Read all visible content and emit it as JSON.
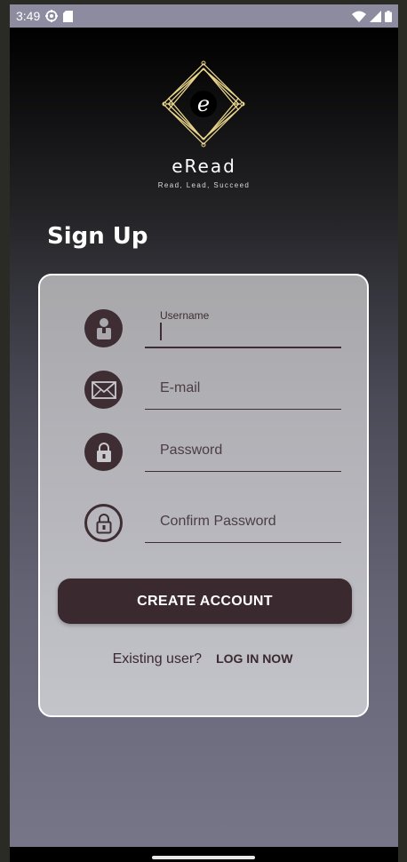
{
  "status_bar": {
    "time": "3:49",
    "left_icons": [
      "settings-icon",
      "sd-card-icon"
    ],
    "right_icons": [
      "wifi-icon",
      "signal-icon",
      "battery-icon"
    ]
  },
  "brand": {
    "logo_letter": "e",
    "name": "eRead",
    "tagline": "Read, Lead, Succeed"
  },
  "heading": "Sign Up",
  "form": {
    "username": {
      "label": "Username",
      "value": "",
      "icon": "user-icon",
      "focused": true
    },
    "email": {
      "placeholder": "E-mail",
      "icon": "mail-icon"
    },
    "password": {
      "placeholder": "Password",
      "icon": "lock-icon"
    },
    "confirm_password": {
      "placeholder": "Confirm Password",
      "icon": "lock-outline-icon"
    },
    "create_button": "CREATE ACCOUNT"
  },
  "footer": {
    "question": "Existing user?",
    "login_link": "LOG IN NOW"
  },
  "colors": {
    "accent": "#3a292e",
    "logo_gold": "#e8d48a",
    "card_border": "#ffffff"
  }
}
